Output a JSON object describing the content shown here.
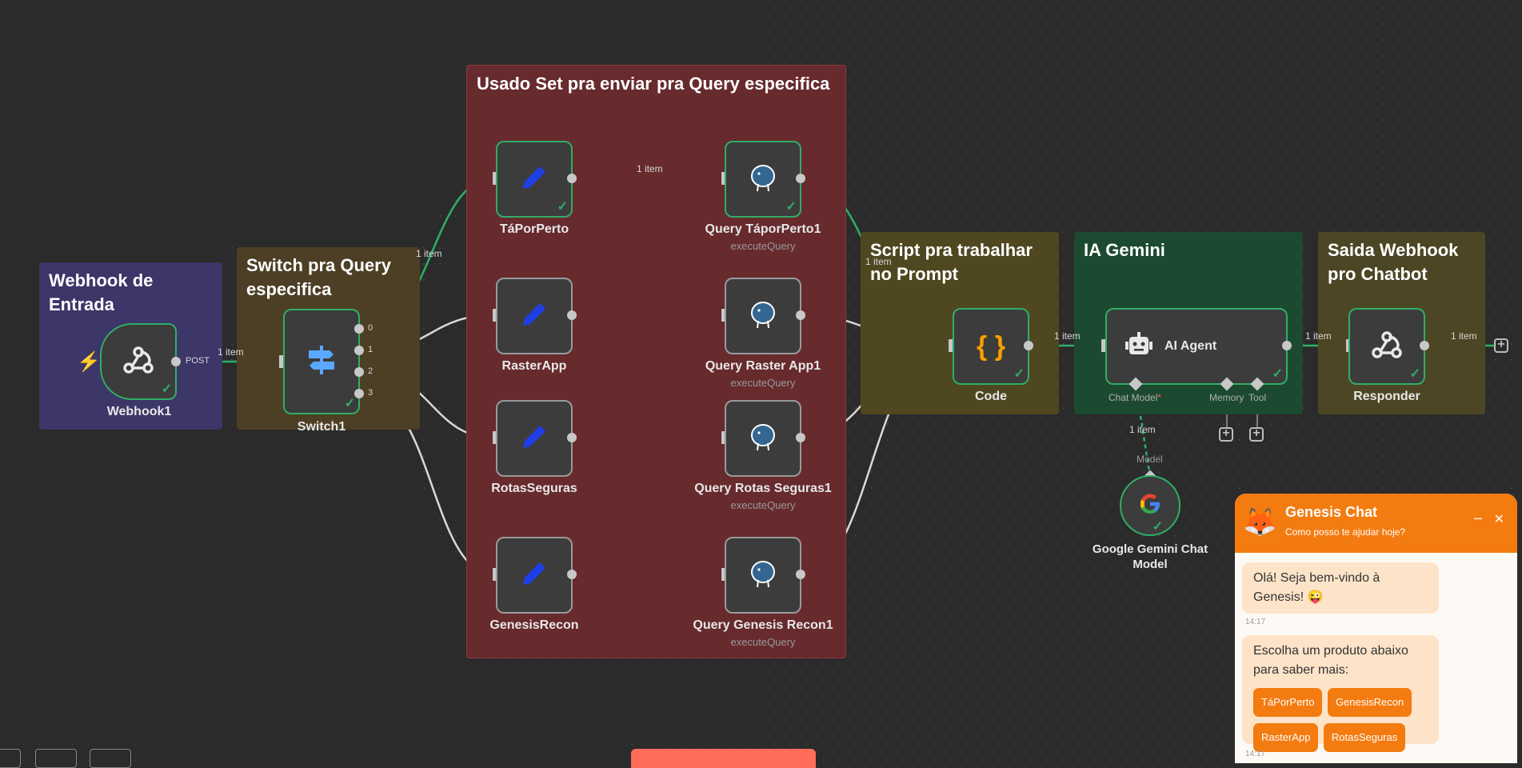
{
  "colors": {
    "canvas": "#2b2b2b",
    "node_border": "#2fae67",
    "node_bg": "#3c3c3c",
    "active_edge": "#2fae67",
    "edge": "#d8d8d8",
    "group_webhook": "#3d3668",
    "group_switch": "#4d3f25",
    "group_set": "#672a2d",
    "group_script": "#4f4720",
    "group_gemini": "#1c4a30",
    "group_responder": "#4d4624",
    "chat_accent": "#f47b10"
  },
  "groups": {
    "webhook": "Webhook de Entrada",
    "switch": "Switch pra Query especifica",
    "set": "Usado Set pra enviar pra Query especifica",
    "script": "Script pra trabalhar no Prompt",
    "gemini": "IA Gemini",
    "responder": "Saida Webhook pro Chatbot"
  },
  "nodes": {
    "webhook1": {
      "name": "Webhook1",
      "icon": "webhook-icon",
      "badge": "POST"
    },
    "switch1": {
      "name": "Switch1",
      "icon": "signpost-icon",
      "outputs": [
        "0",
        "1",
        "2",
        "3"
      ]
    },
    "set_taporperto": {
      "name": "TáPorPerto",
      "icon": "pencil-icon"
    },
    "set_rasterapp": {
      "name": "RasterApp",
      "icon": "pencil-icon"
    },
    "set_rotasseguras": {
      "name": "RotasSeguras",
      "icon": "pencil-icon"
    },
    "set_genesisrecon": {
      "name": "GenesisRecon",
      "icon": "pencil-icon"
    },
    "query_taporperto": {
      "name": "Query TáporPerto1",
      "sub": "executeQuery",
      "icon": "postgres-elephant-icon"
    },
    "query_rasterapp": {
      "name": "Query Raster App1",
      "sub": "executeQuery",
      "icon": "postgres-elephant-icon"
    },
    "query_rotasseguras": {
      "name": "Query Rotas Seguras1",
      "sub": "executeQuery",
      "icon": "postgres-elephant-icon"
    },
    "query_genesisrecon": {
      "name": "Query Genesis Recon1",
      "sub": "executeQuery",
      "icon": "postgres-elephant-icon"
    },
    "code": {
      "name": "Code",
      "icon": "curly-braces-icon",
      "glyph": "{ }"
    },
    "ai_agent": {
      "name": "AI Agent",
      "icon": "robot-icon",
      "ports": {
        "chat_model": "Chat Model",
        "required": "*",
        "memory": "Memory",
        "tool": "Tool"
      }
    },
    "gemini_model": {
      "name": "Google Gemini Chat Model",
      "icon": "google-g-icon",
      "port": "Model"
    },
    "responder": {
      "name": "Responder",
      "icon": "webhook-icon"
    }
  },
  "edge_labels": {
    "webhook_switch": "1 item",
    "switch_set": "1 item",
    "set_query": "1 item",
    "query_code": "1 item",
    "code_agent": "1 item",
    "agent_responder": "1 item",
    "responder_out": "1 item",
    "model_agent": "1 item"
  },
  "chat": {
    "title": "Genesis Chat",
    "subtitle": "Como posso te ajudar hoje?",
    "avatar": "fox-icon",
    "minimize": "–",
    "close": "✕",
    "messages": [
      {
        "text": "Olá! Seja bem-vindo à Genesis! 😜",
        "time": "14:17"
      },
      {
        "text": "Escolha um produto abaixo para saber mais:",
        "time": "14:17"
      }
    ],
    "options": [
      "TáPorPerto",
      "GenesisRecon",
      "RasterApp",
      "RotasSeguras"
    ]
  },
  "plus": "+"
}
